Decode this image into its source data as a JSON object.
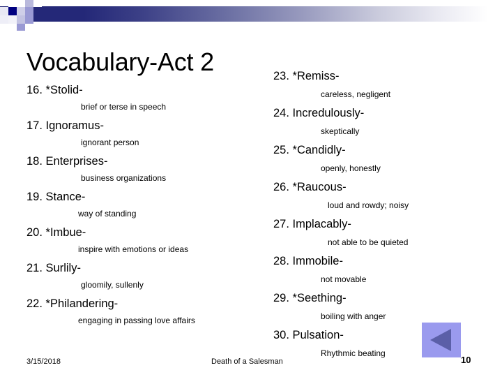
{
  "slide": {
    "title": "Vocabulary-Act 2",
    "page_number": "10",
    "footer_date": "3/15/2018",
    "footer_center": "Death of a Salesman"
  },
  "colors": {
    "band_dark": "#242878",
    "band_light": "#ffffff",
    "mosaic_navy": "#000080",
    "mosaic_mid": "#9a9ad4",
    "mosaic_pale": "#c8c8e4",
    "nav_button_bg": "#9a9aee",
    "nav_arrow": "#5b5fa8"
  },
  "nav": {
    "back_button_icon": "triangle-left-icon"
  },
  "left_column": [
    {
      "number": "16.",
      "term": "*Stolid-",
      "definition": "brief or terse in speech"
    },
    {
      "number": "17.",
      "term": "Ignoramus-",
      "definition": "ignorant person"
    },
    {
      "number": "18.",
      "term": "Enterprises-",
      "definition": "business organizations"
    },
    {
      "number": "19.",
      "term": "Stance-",
      "definition": "way of standing"
    },
    {
      "number": "20.",
      "term": "*Imbue-",
      "definition": "inspire with emotions or ideas"
    },
    {
      "number": "21.",
      "term": "Surlily-",
      "definition": "gloomily, sullenly"
    },
    {
      "number": "22.",
      "term": "*Philandering-",
      "definition": "engaging in passing love affairs"
    }
  ],
  "right_column": [
    {
      "number": "23.",
      "term": "*Remiss-",
      "definition": "careless, negligent"
    },
    {
      "number": "24.",
      "term": "Incredulously-",
      "definition": "skeptically"
    },
    {
      "number": "25.",
      "term": "*Candidly-",
      "definition": "openly, honestly"
    },
    {
      "number": "26.",
      "term": "*Raucous-",
      "definition": "loud and rowdy; noisy"
    },
    {
      "number": "27.",
      "term": "Implacably-",
      "definition": "not able to be quieted"
    },
    {
      "number": "28.",
      "term": "Immobile-",
      "definition": "not movable"
    },
    {
      "number": "29.",
      "term": "*Seething-",
      "definition": "boiling with anger"
    },
    {
      "number": "30.",
      "term": "Pulsation-",
      "definition": "Rhythmic beating"
    }
  ],
  "left_text": [
    "16.  *Stolid-",
    "brief or terse in speech",
    "17. Ignoramus-",
    "ignorant person",
    "18. Enterprises-",
    "business organizations",
    "19. Stance-",
    "way of standing",
    "20. *Imbue-",
    "inspire with emotions or ideas",
    "21.  Surlily-",
    "gloomily, sullenly",
    "22.  *Philandering-",
    "engaging in passing love affairs"
  ],
  "right_text": [
    "23. *Remiss-",
    "careless, negligent",
    "24.   Incredulously-",
    "skeptically",
    "25. *Candidly-",
    "openly, honestly",
    "26. *Raucous-",
    "loud and rowdy; noisy",
    "27.   Implacably-",
    "not able to be quieted",
    "28.   Immobile-",
    "not movable",
    "29.  *Seething-",
    "boiling with anger",
    "30.  Pulsation-",
    "Rhythmic beating"
  ]
}
